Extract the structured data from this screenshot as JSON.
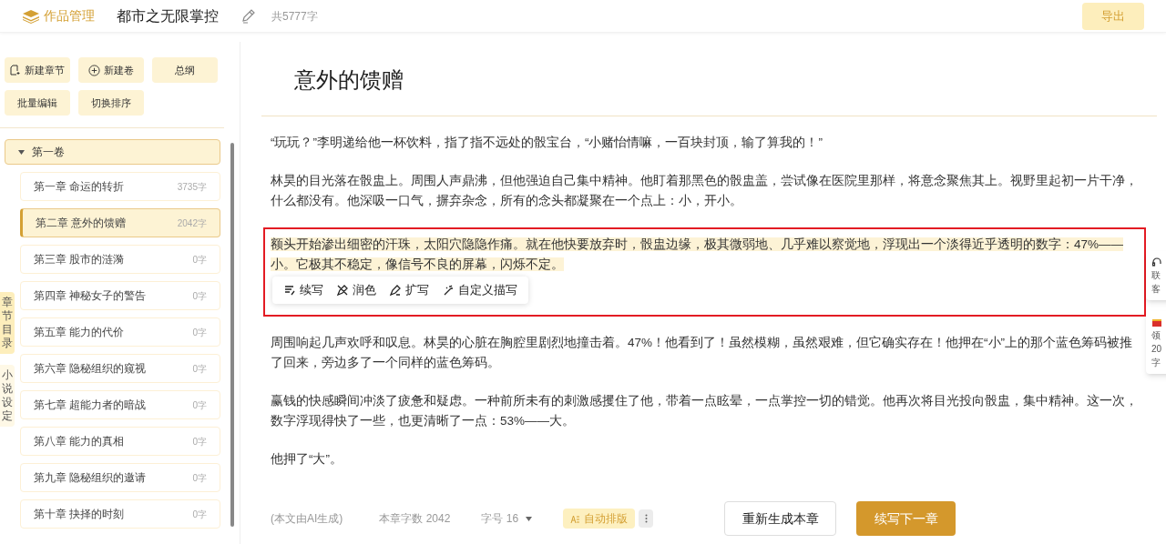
{
  "header": {
    "brand": "作品管理",
    "book_title": "都市之无限掌控",
    "word_total": "共5777字",
    "export_button": "导出"
  },
  "sidebar": {
    "actions": [
      {
        "label": "新建章节"
      },
      {
        "label": "新建卷"
      },
      {
        "label": "总纲"
      },
      {
        "label": "批量编辑"
      },
      {
        "label": "切换排序"
      }
    ],
    "side_tabs": [
      {
        "label": "章节目录",
        "selected": true
      },
      {
        "label": "小说设定",
        "selected": false
      }
    ],
    "volume": {
      "label": "第一卷",
      "expanded": true
    },
    "chapters": [
      {
        "title": "第一章 命运的转折",
        "count": "3735字",
        "selected": false
      },
      {
        "title": "第二章 意外的馈赠",
        "count": "2042字",
        "selected": true
      },
      {
        "title": "第三章 股市的涟漪",
        "count": "0字",
        "selected": false
      },
      {
        "title": "第四章 神秘女子的警告",
        "count": "0字",
        "selected": false
      },
      {
        "title": "第五章 能力的代价",
        "count": "0字",
        "selected": false
      },
      {
        "title": "第六章 隐秘组织的窥视",
        "count": "0字",
        "selected": false
      },
      {
        "title": "第七章 超能力者的暗战",
        "count": "0字",
        "selected": false
      },
      {
        "title": "第八章 能力的真相",
        "count": "0字",
        "selected": false
      },
      {
        "title": "第九章 隐秘组织的邀请",
        "count": "0字",
        "selected": false
      },
      {
        "title": "第十章 抉择的时刻",
        "count": "0字",
        "selected": false
      }
    ]
  },
  "editor": {
    "chapter_title": "意外的馈赠",
    "paragraphs": [
      {
        "text": "“玩玩？”李明递给他一杯饮料，指了指不远处的骰宝台，“小赌怡情嘛，一百块封顶，输了算我的！”",
        "highlighted": false
      },
      {
        "text": "林昊的目光落在骰盅上。周围人声鼎沸，但他强迫自己集中精神。他盯着那黑色的骰盅盖，尝试像在医院里那样，将意念聚焦其上。视野里起初一片干净，什么都没有。他深吸一口气，摒弃杂念，所有的念头都凝聚在一个点上：小，开小。",
        "highlighted": false
      },
      {
        "text": "额头开始渗出细密的汗珠，太阳穴隐隐作痛。就在他快要放弃时，骰盅边缘，极其微弱地、几乎难以察觉地，浮现出一个淡得近乎透明的数字：47%——小。它极其不稳定，像信号不良的屏幕，闪烁不定。",
        "highlighted": true
      },
      {
        "text": "周围响起几声欢呼和叹息。林昊的心脏在胸腔里剧烈地撞击着。47%！他看到了！虽然模糊，虽然艰难，但它确实存在！他押在“小”上的那个蓝色筹码被推了回来，旁边多了一个同样的蓝色筹码。",
        "highlighted": false
      },
      {
        "text": "赢钱的快感瞬间冲淡了疲惫和疑虑。一种前所未有的刺激感攫住了他，带着一点眩晕，一点掌控一切的错觉。他再次将目光投向骰盅，集中精神。这一次，数字浮现得快了一些，也更清晰了一点：53%——大。",
        "highlighted": false
      },
      {
        "text": "他押了“大”。",
        "highlighted": false
      }
    ],
    "ai_tools": [
      {
        "label": "续写"
      },
      {
        "label": "润色"
      },
      {
        "label": "扩写"
      },
      {
        "label": "自定义描写"
      }
    ]
  },
  "footer": {
    "ai_note": "(本文由AI生成)",
    "chapter_count": "本章字数 2042",
    "font_size": "字号 16",
    "auto_layout": {
      "label": "自动排版",
      "on": true
    },
    "regenerate_button": "重新生成本章",
    "continue_button": "续写下一章"
  },
  "floating": [
    {
      "kind": "service",
      "lines": [
        "联",
        "客"
      ]
    },
    {
      "kind": "gift",
      "lines": [
        "领",
        "20",
        "字"
      ]
    }
  ]
}
